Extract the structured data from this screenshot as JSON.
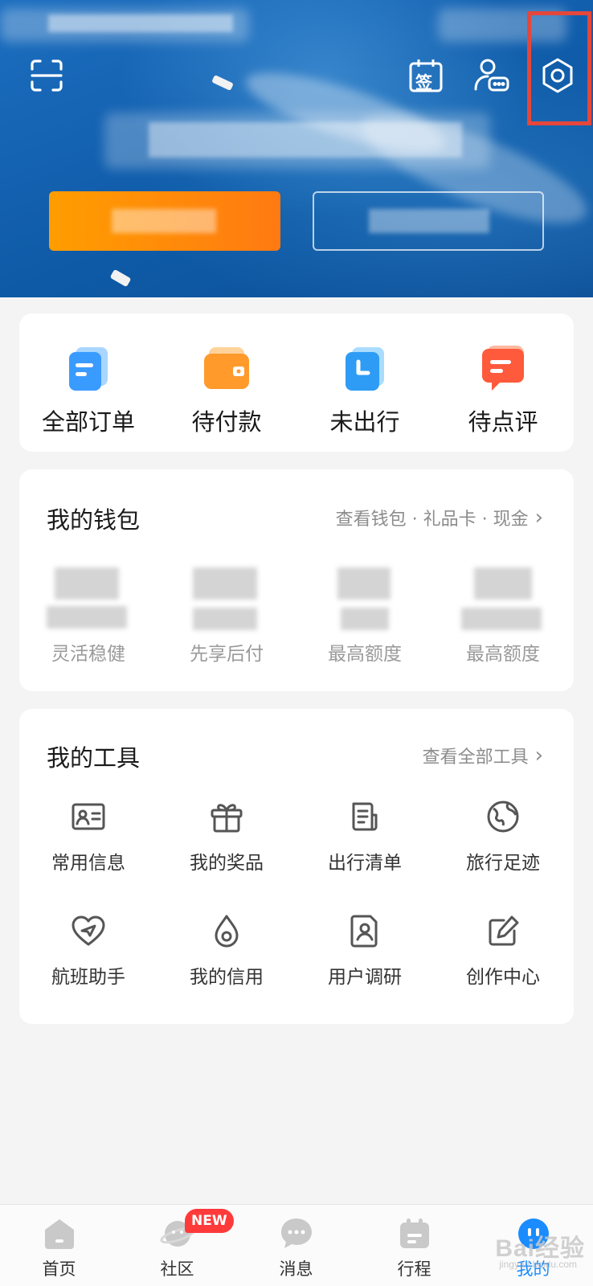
{
  "header": {
    "icons": {
      "scan": "scan-icon",
      "sign_in": "sign-in-calendar-icon",
      "sign_in_text": "签",
      "service": "customer-service-icon",
      "settings": "gear-icon"
    },
    "highlight_color": "#e4473b"
  },
  "orders": {
    "items": [
      {
        "label": "全部订单",
        "icon": "all-orders-icon",
        "color": "#3a9bff"
      },
      {
        "label": "待付款",
        "icon": "wallet-icon",
        "color": "#ff9a2b"
      },
      {
        "label": "未出行",
        "icon": "clock-icon",
        "color": "#2e9cf5"
      },
      {
        "label": "待点评",
        "icon": "comment-icon",
        "color": "#ff5a3c"
      }
    ]
  },
  "wallet": {
    "title": "我的钱包",
    "link": "查看钱包 · 礼品卡 · 现金",
    "items": [
      {
        "label": "灵活稳健"
      },
      {
        "label": "先享后付"
      },
      {
        "label": "最高额度"
      },
      {
        "label": "最高额度"
      }
    ]
  },
  "tools": {
    "title": "我的工具",
    "link": "查看全部工具",
    "items": [
      {
        "label": "常用信息",
        "icon": "id-card-icon"
      },
      {
        "label": "我的奖品",
        "icon": "gift-icon"
      },
      {
        "label": "出行清单",
        "icon": "checklist-icon"
      },
      {
        "label": "旅行足迹",
        "icon": "globe-icon"
      },
      {
        "label": "航班助手",
        "icon": "flight-heart-icon"
      },
      {
        "label": "我的信用",
        "icon": "credit-drop-icon"
      },
      {
        "label": "用户调研",
        "icon": "survey-icon"
      },
      {
        "label": "创作中心",
        "icon": "edit-icon"
      }
    ]
  },
  "bottom_nav": {
    "items": [
      {
        "label": "首页",
        "icon": "home-icon"
      },
      {
        "label": "社区",
        "icon": "community-planet-icon"
      },
      {
        "label": "消息",
        "icon": "message-icon"
      },
      {
        "label": "行程",
        "icon": "trip-icon"
      },
      {
        "label": "我的",
        "icon": "profile-icon",
        "active": true
      }
    ],
    "badge": "NEW",
    "active_color": "#1a8cff"
  },
  "watermark": {
    "text": "Bai经验",
    "sub": "jingyan.baidu.com"
  }
}
